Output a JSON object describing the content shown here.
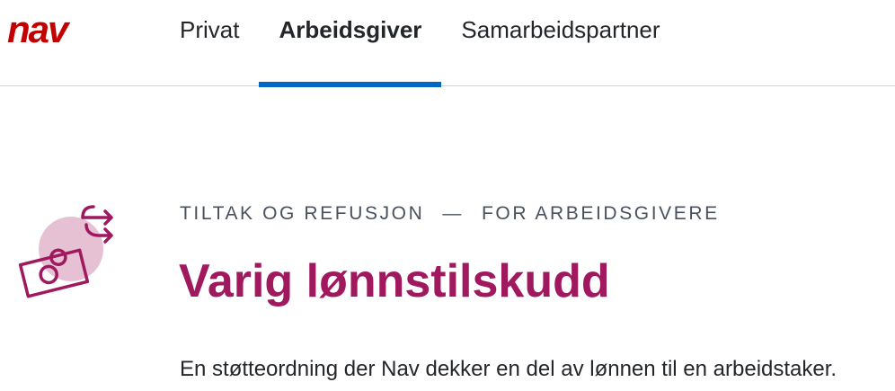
{
  "header": {
    "logo_text": "nav",
    "tabs": [
      {
        "label": "Privat",
        "active": false
      },
      {
        "label": "Arbeidsgiver",
        "active": true
      },
      {
        "label": "Samarbeidspartner",
        "active": false
      }
    ]
  },
  "hero": {
    "category": "Tiltak og refusjon",
    "separator": "—",
    "audience": "For arbeidsgivere",
    "title": "Varig lønnstilskudd",
    "ingress": "En støtteordning der Nav dekker en del av lønnen til en arbeidstaker.",
    "icon": "money-exchange-icon"
  },
  "colors": {
    "brand_red": "#c30000",
    "active_tab_underline": "#0067c5",
    "title_color": "#a0195f",
    "icon_fill": "#e6c1d4"
  }
}
